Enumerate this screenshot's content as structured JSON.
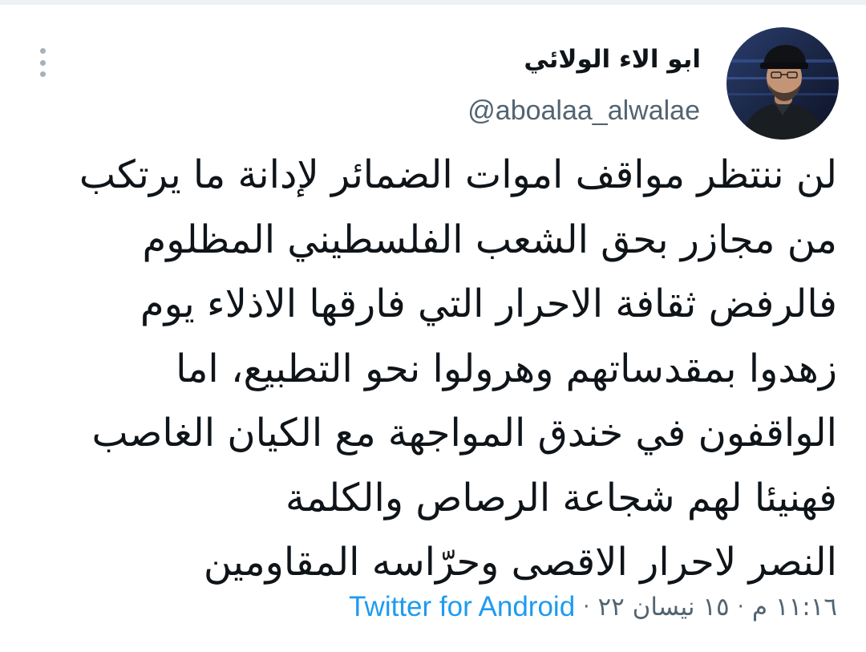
{
  "author": {
    "display_name": "ابو الاء الولائي",
    "handle": "@aboalaa_alwalae"
  },
  "tweet": {
    "lines": [
      "لن ننتظر مواقف اموات الضمائر لإدانة ما يرتكب",
      "من مجازر بحق الشعب الفلسطيني المظلوم",
      "فالرفض ثقافة الاحرار التي فارقها الاذلاء يوم",
      "زهدوا بمقدساتهم وهرولوا نحو التطبيع، اما",
      "الواقفون في خندق المواجهة مع الكيان الغاصب",
      "فهنيئا لهم شجاعة الرصاص والكلمة",
      "النصر لاحرار الاقصى وحرّاسه المقاومين"
    ],
    "time": "١١:١٦ م",
    "date": "١٥ نيسان ٢٢",
    "separator": "·",
    "source": "Twitter for Android"
  },
  "icons": {
    "more": "more-vertical-icon",
    "avatar": "profile-avatar"
  },
  "colors": {
    "text": "#0f1419",
    "secondary": "#536471",
    "link": "#1d9bf0",
    "more_icon": "#a6b1bb"
  }
}
